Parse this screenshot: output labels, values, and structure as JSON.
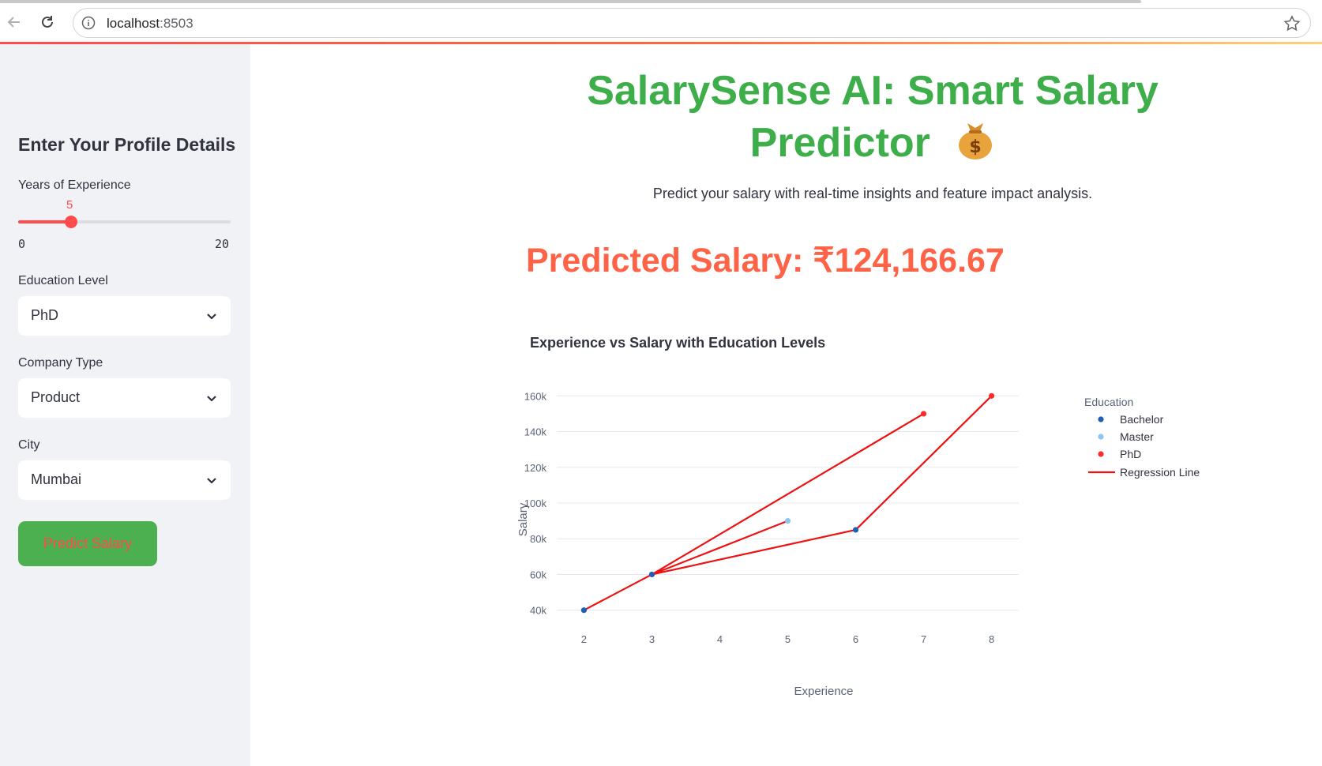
{
  "browser": {
    "url_host": "localhost",
    "url_port": ":8503",
    "icons": [
      "back-arrow-icon",
      "reload-icon",
      "info-icon",
      "star-icon"
    ]
  },
  "sidebar": {
    "title": "Enter Your Profile Details",
    "experience": {
      "label": "Years of Experience",
      "value": "5",
      "min": "0",
      "max": "20",
      "fraction": 0.25
    },
    "education": {
      "label": "Education Level",
      "selected": "PhD"
    },
    "company": {
      "label": "Company Type",
      "selected": "Product"
    },
    "city": {
      "label": "City",
      "selected": "Mumbai"
    },
    "predict_button": "Predict Salary"
  },
  "main": {
    "title_line1": "SalarySense AI: Smart Salary",
    "title_line2": "Predictor",
    "title_icon": "money-bag-icon",
    "subtitle": "Predict your salary with real-time insights and feature impact analysis.",
    "prediction": "Predicted Salary: ₹124,166.67"
  },
  "colors": {
    "accent": "#ff4b4b",
    "title_green": "#3dae4a",
    "prediction": "#ff6347",
    "button_bg": "#4caf50"
  },
  "chart_data": {
    "type": "scatter",
    "title": "Experience vs Salary with Education Levels",
    "xlabel": "Experience",
    "ylabel": "Salary",
    "xlim": [
      1.6,
      8.4
    ],
    "ylim": [
      35000,
      165000
    ],
    "x_ticks": [
      2,
      3,
      4,
      5,
      6,
      7,
      8
    ],
    "y_ticks": [
      40000,
      60000,
      80000,
      100000,
      120000,
      140000,
      160000
    ],
    "y_tick_labels": [
      "40k",
      "60k",
      "80k",
      "100k",
      "120k",
      "140k",
      "160k"
    ],
    "legend_title": "Education",
    "legend_position": "top-right",
    "series": [
      {
        "name": "Bachelor",
        "color": "#1f5fb4",
        "points": [
          [
            2,
            40000
          ],
          [
            3,
            60000
          ],
          [
            6,
            85000
          ]
        ]
      },
      {
        "name": "Master",
        "color": "#8ec4ee",
        "points": [
          [
            5,
            90000
          ]
        ]
      },
      {
        "name": "PhD",
        "color": "#ff2b2b",
        "points": [
          [
            7,
            150000
          ],
          [
            8,
            160000
          ]
        ]
      }
    ],
    "regression": {
      "name": "Regression Line",
      "color": "#ee1111",
      "path": [
        [
          2,
          40000
        ],
        [
          3,
          60000
        ],
        [
          7,
          150000
        ],
        [
          3,
          60000
        ],
        [
          5,
          90000
        ],
        [
          3,
          60000
        ],
        [
          6,
          85000
        ],
        [
          8,
          160000
        ]
      ]
    }
  }
}
